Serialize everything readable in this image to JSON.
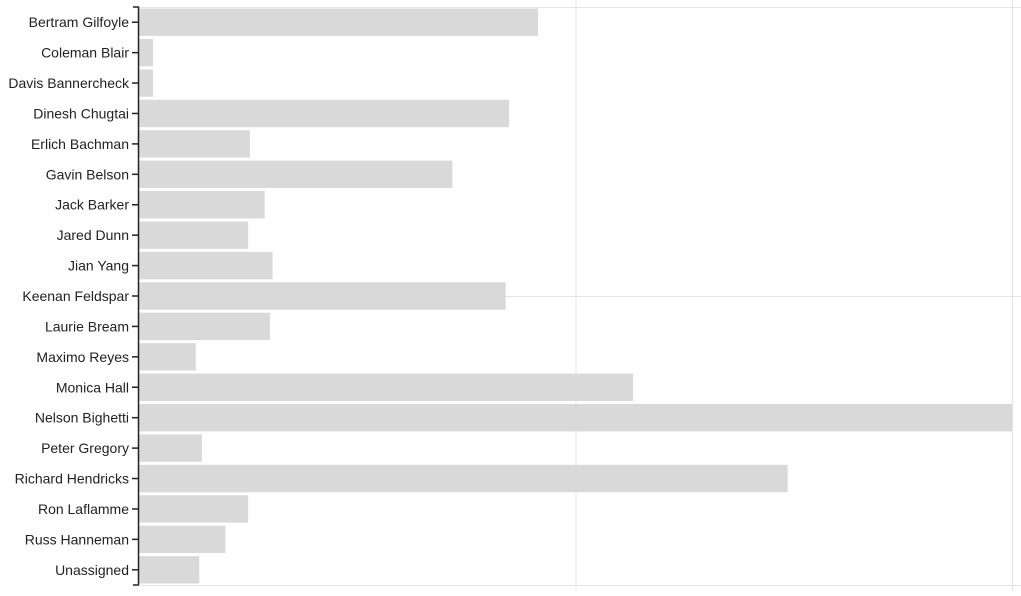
{
  "chart_data": {
    "type": "bar",
    "orientation": "horizontal",
    "title": "",
    "xlabel": "",
    "ylabel": "",
    "xlim": [
      0,
      100
    ],
    "grid": true,
    "bar_color": "#d9d9d9",
    "grid_color": "#e3e3e3",
    "categories": [
      "Bertram Gilfoyle",
      "Coleman Blair",
      "Davis Bannercheck",
      "Dinesh Chugtai",
      "Erlich Bachman",
      "Gavin Belson",
      "Jack Barker",
      "Jared Dunn",
      "Jian Yang",
      "Keenan Feldspar",
      "Laurie Bream",
      "Maximo Reyes",
      "Monica Hall",
      "Nelson Bighetti",
      "Peter Gregory",
      "Richard Hendricks",
      "Ron Laflamme",
      "Russ Hanneman",
      "Unassigned"
    ],
    "values": [
      45.7,
      1.6,
      1.6,
      42.4,
      12.7,
      35.9,
      14.4,
      12.5,
      15.3,
      42.0,
      15.0,
      6.5,
      56.6,
      100,
      7.2,
      74.3,
      12.5,
      9.9,
      6.9
    ]
  }
}
